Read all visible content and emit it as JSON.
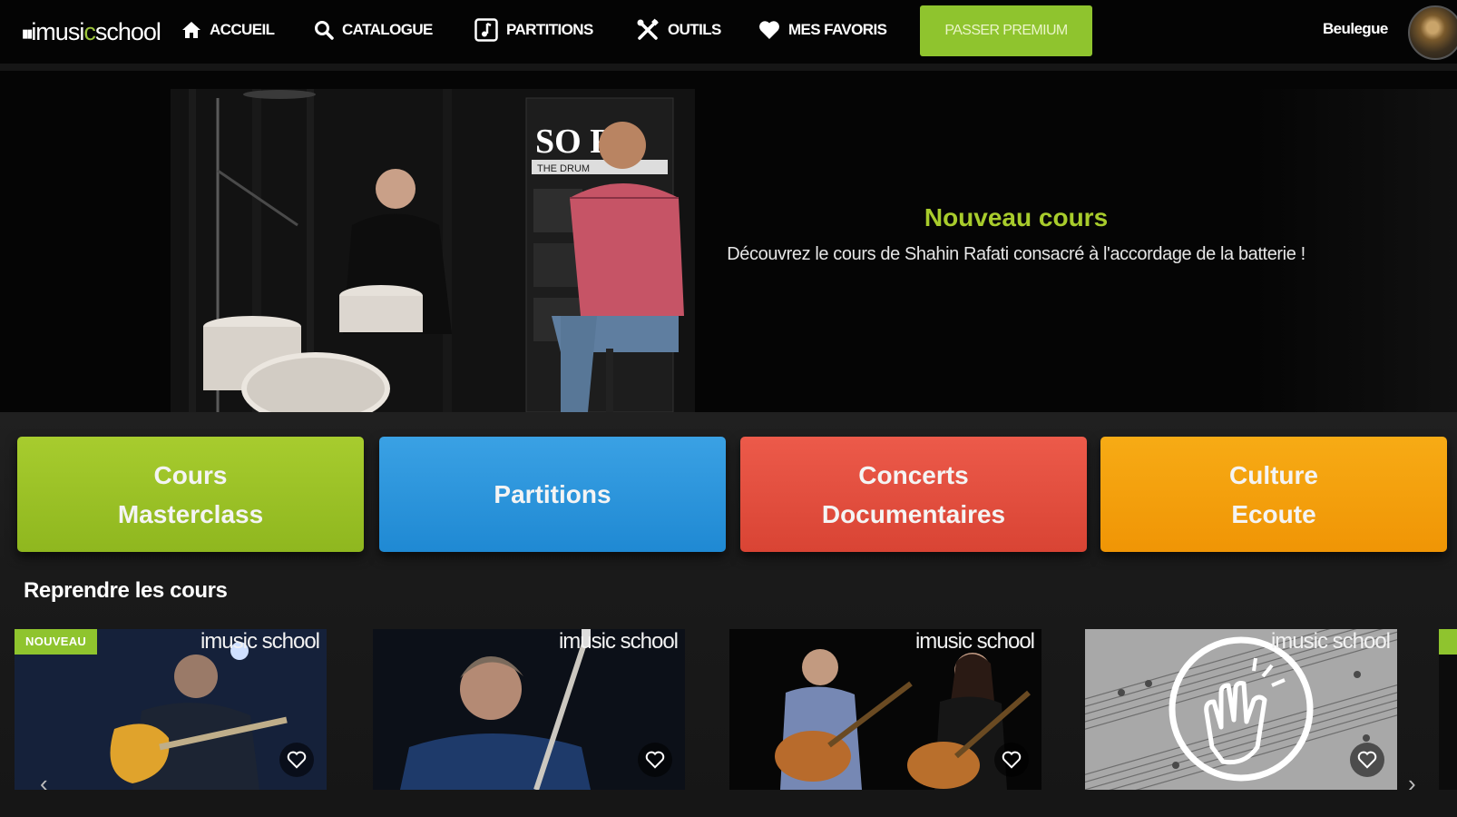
{
  "header": {
    "logo": {
      "pre": "imusi",
      "accent": "c",
      "post": "school"
    },
    "nav": [
      {
        "label": "ACCUEIL",
        "icon": "home-icon"
      },
      {
        "label": "CATALOGUE",
        "icon": "search-icon"
      },
      {
        "label": "PARTITIONS",
        "icon": "music-note-icon"
      },
      {
        "label": "OUTILS",
        "icon": "tools-icon"
      },
      {
        "label": "MES FAVORIS",
        "icon": "heart-icon"
      }
    ],
    "premium_label": "PASSER PREMIUM",
    "username": "Beulegue"
  },
  "hero": {
    "title": "Nouveau cours",
    "text": "Découvrez le cours de Shahin Rafati consacré à l'accordage de la batterie !",
    "banner_text": "SO R",
    "banner_subtext": "THE DRUM"
  },
  "categories": [
    {
      "label": "Cours\nMasterclass",
      "color": "#9cc32a"
    },
    {
      "label": "Partitions",
      "color": "#2d95dc"
    },
    {
      "label": "Concerts\nDocumentaires",
      "color": "#e24f3f"
    },
    {
      "label": "Culture\nEcoute",
      "color": "#f4a00c"
    }
  ],
  "resume": {
    "title": "Reprendre les cours",
    "cards": [
      {
        "badge": "NOUVEAU",
        "watermark": "imusic school",
        "scene": "guitarist-jazz"
      },
      {
        "watermark": "imusic school",
        "scene": "guitarist-electric"
      },
      {
        "watermark": "imusic school",
        "scene": "classical-duo"
      },
      {
        "watermark": "imusic school",
        "scene": "sheet-music-applause"
      }
    ]
  },
  "colors": {
    "accent": "#8fc42e",
    "background": "#161616",
    "topbar": "#040404"
  }
}
